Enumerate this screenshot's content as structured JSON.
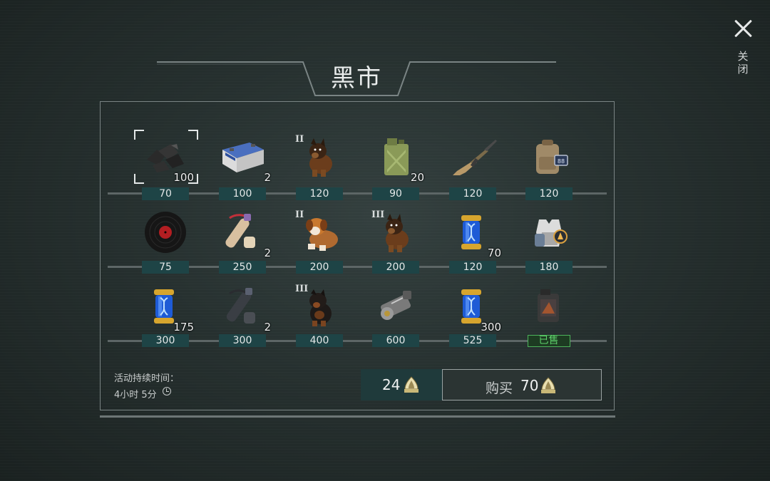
{
  "title": "黑市",
  "close_label": "关闭",
  "rows": [
    [
      {
        "name": "coal",
        "icon": "coal-icon",
        "qty": "100",
        "tier": "",
        "price": "70",
        "selected": true
      },
      {
        "name": "battery",
        "icon": "car-battery-icon",
        "qty": "2",
        "tier": "",
        "price": "100"
      },
      {
        "name": "dog",
        "icon": "german-shepherd-puppy-icon",
        "qty": "",
        "tier": "II",
        "price": "120"
      },
      {
        "name": "jerrycan",
        "icon": "jerrycan-icon",
        "qty": "20",
        "tier": "",
        "price": "90"
      },
      {
        "name": "rifle",
        "icon": "assault-rifle-icon",
        "qty": "",
        "tier": "",
        "price": "120"
      },
      {
        "name": "backpack",
        "icon": "backpack-icon",
        "qty": "",
        "tier": "",
        "price": "120"
      }
    ],
    [
      {
        "name": "vinyl",
        "icon": "vinyl-record-icon",
        "qty": "",
        "tier": "",
        "price": "75"
      },
      {
        "name": "scroll",
        "icon": "blueprint-scroll-icon",
        "qty": "2",
        "tier": "",
        "price": "250"
      },
      {
        "name": "dog",
        "icon": "st-bernard-puppy-icon",
        "qty": "",
        "tier": "II",
        "price": "200"
      },
      {
        "name": "dog",
        "icon": "german-shepherd-puppy-icon",
        "qty": "",
        "tier": "III",
        "price": "200"
      },
      {
        "name": "capsule",
        "icon": "dna-capsule-icon",
        "qty": "70",
        "tier": "",
        "price": "120"
      },
      {
        "name": "vest",
        "icon": "armor-vest-icon",
        "qty": "",
        "tier": "",
        "price": "180"
      }
    ],
    [
      {
        "name": "capsule",
        "icon": "dna-capsule-icon",
        "qty": "175",
        "tier": "",
        "price": "300"
      },
      {
        "name": "scroll",
        "icon": "dark-scroll-icon",
        "qty": "2",
        "tier": "",
        "price": "300"
      },
      {
        "name": "dog",
        "icon": "rottweiler-puppy-icon",
        "qty": "",
        "tier": "III",
        "price": "400"
      },
      {
        "name": "engine",
        "icon": "engine-part-icon",
        "qty": "",
        "tier": "",
        "price": "600"
      },
      {
        "name": "capsule",
        "icon": "dna-capsule-icon",
        "qty": "300",
        "tier": "",
        "price": "525"
      },
      {
        "name": "canister",
        "icon": "fuel-canister-icon",
        "qty": "",
        "tier": "",
        "price": "已售",
        "sold": true
      }
    ]
  ],
  "duration": {
    "label": "活动持续时间：",
    "value": "4小时 5分"
  },
  "balance": "24",
  "buy": {
    "label": "购买",
    "amount": "70"
  },
  "colors": {
    "price_bg": "#1e4446",
    "sold": "#4db35a",
    "panel_border": "#7a8484"
  }
}
